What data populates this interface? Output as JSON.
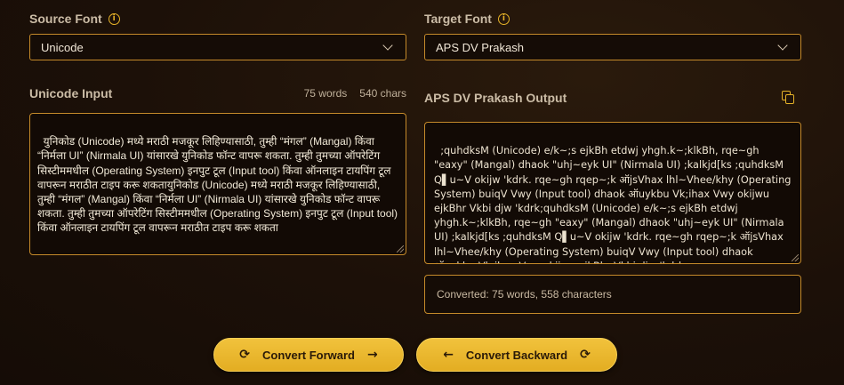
{
  "source_font": {
    "label": "Source Font",
    "info_icon": "i",
    "selected": "Unicode"
  },
  "target_font": {
    "label": "Target Font",
    "info_icon": "i",
    "selected": "APS DV Prakash"
  },
  "input": {
    "label": "Unicode Input",
    "words": "75 words",
    "chars": "540 chars",
    "text": "युनिकोड (Unicode) मध्ये मराठी मजकूर लिहिण्यासाठी, तुम्ही “मंगल” (Mangal) किंवा “निर्मला UI” (Nirmala UI) यांसारखे युनिकोड फॉन्ट वापरू शकता. तुम्ही तुमच्या ऑपरेटिंग सिस्टीममधील (Operating System) इनपुट टूल (Input tool) किंवा ऑनलाइन टायपिंग टूल वापरून मराठीत टाइप करू शकतायुनिकोड (Unicode) मध्ये मराठी मजकूर लिहिण्यासाठी, तुम्ही “मंगल” (Mangal) किंवा “निर्मला UI” (Nirmala UI) यांसारखे युनिकोड फॉन्ट वापरू शकता. तुम्ही तुमच्या ऑपरेटिंग सिस्टीममधील (Operating System) इनपुट टूल (Input tool) किंवा ऑनलाइन टायपिंग टूल वापरून मराठीत टाइप करू शकता"
  },
  "output": {
    "label": "APS DV Prakash Output",
    "copy_icon": "copy-icon",
    "text": ";quhdksM (Unicode) e/k~;s ejkBh etdwj yhgh.k~;klkBh, rqe~gh \"eaxy\" (Mangal) dhaok \"uhj~eyk UI\" (Nirmala UI) ;kalkjd[ks ;quhdksM Q▌u~V okijw 'kdrk. rqe~gh rqep~;k ऑjsVhax lhl~Vhee/khy (Operating System) buiqV Vwy (Input tool) dhaok ऑuykbu Vk;ihax Vwy okijwu ejkBhr Vkbi djw 'kdrk;quhdksM (Unicode) e/k~;s ejkBh etdwj yhgh.k~;klkBh, rqe~gh \"eaxy\" (Mangal) dhaok \"uhj~eyk UI\" (Nirmala UI) ;kalkjd[ks ;quhdksM Q▌u~V okijw 'kdrk. rqe~gh rqep~;k ऑjsVhax lhl~Vhee/khy (Operating System) buiqV Vwy (Input tool) dhaok ऑuykbu Vk;ihax Vwy okijwu ejkBhr Vkbi djw 'kdrk"
  },
  "status": "Converted: 75 words, 558 characters",
  "buttons": {
    "forward": "Convert Forward",
    "backward": "Convert Backward"
  },
  "colors": {
    "accent": "#e6b228",
    "border": "#c58a2a",
    "background": "#1c1008"
  }
}
